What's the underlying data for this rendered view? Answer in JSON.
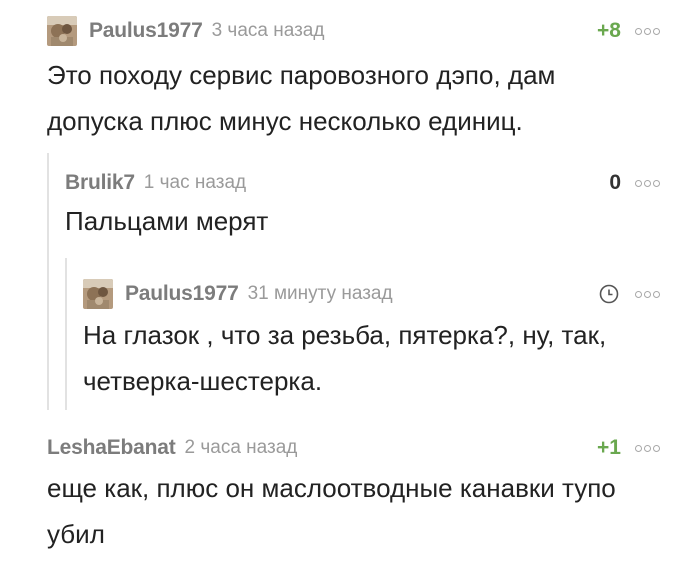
{
  "comments": [
    {
      "author": "Paulus1977",
      "time": "3 часа назад",
      "rating": "+8",
      "text_lines": [
        "Это походу сервис паровозного дэпо, дам",
        "допуска плюс минус несколько единиц."
      ],
      "icon": "more-options-icon"
    },
    {
      "author": "Brulik7",
      "time": "1 час назад",
      "rating": "0",
      "text_lines": [
        "Пальцами мерят"
      ],
      "icon": "more-options-icon"
    },
    {
      "author": "Paulus1977",
      "time": "31 минуту назад",
      "rating_icon": "clock-icon",
      "text_lines": [
        "На глазок , что за резьба, пятерка?, ну, так,",
        "четверка-шестерка."
      ],
      "icon": "more-options-icon"
    },
    {
      "author": "LeshaEbanat",
      "time": "2 часа назад",
      "rating": "+1",
      "text_lines": [
        "еще как, плюс он маслоотводные канавки тупо",
        "убил"
      ],
      "icon": "more-options-icon"
    }
  ],
  "colors": {
    "positive_rating": "#6aa84f",
    "author": "#7c7c7c",
    "time": "#9a9a9a",
    "thread_line": "#e2e2e2"
  }
}
